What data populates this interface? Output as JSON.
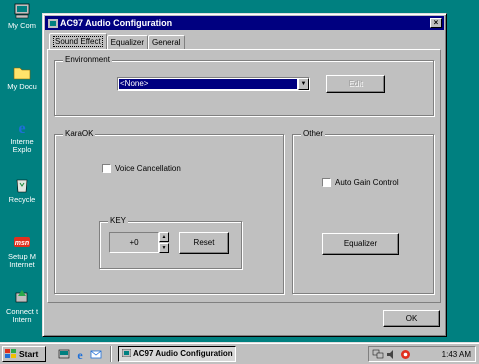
{
  "desktop": {
    "icons": [
      {
        "label": "My Com",
        "icon": "my-computer-icon"
      },
      {
        "label": "My Docu",
        "icon": "folder-icon"
      },
      {
        "label": "Interne Explo",
        "icon": "internet-explorer-icon"
      },
      {
        "label": "Recycle",
        "icon": "recycle-bin-icon"
      },
      {
        "label": "Setup M Internet",
        "icon": "msn-setup-icon"
      },
      {
        "label": "Connect t Intern",
        "icon": "connect-internet-icon"
      }
    ]
  },
  "window": {
    "title": "AC97 Audio Configuration",
    "close_glyph": "×",
    "tabs": [
      {
        "label": "Sound Effect",
        "active": true
      },
      {
        "label": "Equalizer",
        "active": false
      },
      {
        "label": "General",
        "active": false
      }
    ],
    "environment": {
      "legend": "Environment",
      "selected": "<None>",
      "edit_label": "Edit",
      "edit_enabled": false
    },
    "karaok": {
      "legend": "KaraOK",
      "voice_cancellation_label": "Voice Cancellation",
      "voice_cancellation_checked": false,
      "key": {
        "legend": "KEY",
        "value": "+0",
        "reset_label": "Reset"
      }
    },
    "other": {
      "legend": "Other",
      "auto_gain_label": "Auto Gain Control",
      "auto_gain_checked": false,
      "equalizer_label": "Equalizer"
    },
    "ok_label": "OK"
  },
  "taskbar": {
    "start_label": "Start",
    "quick_launch_icons": [
      "show-desktop-icon",
      "internet-explorer-icon",
      "outlook-express-icon"
    ],
    "active_task": "AC97 Audio Configuration",
    "clock": "1:43 AM",
    "tray_icons": [
      "network-icon",
      "speaker-icon",
      "audio-config-icon"
    ]
  },
  "colors": {
    "desktop": "#008080",
    "titlebar": "#000080",
    "face": "#c0c0c0",
    "selection": "#000080"
  }
}
